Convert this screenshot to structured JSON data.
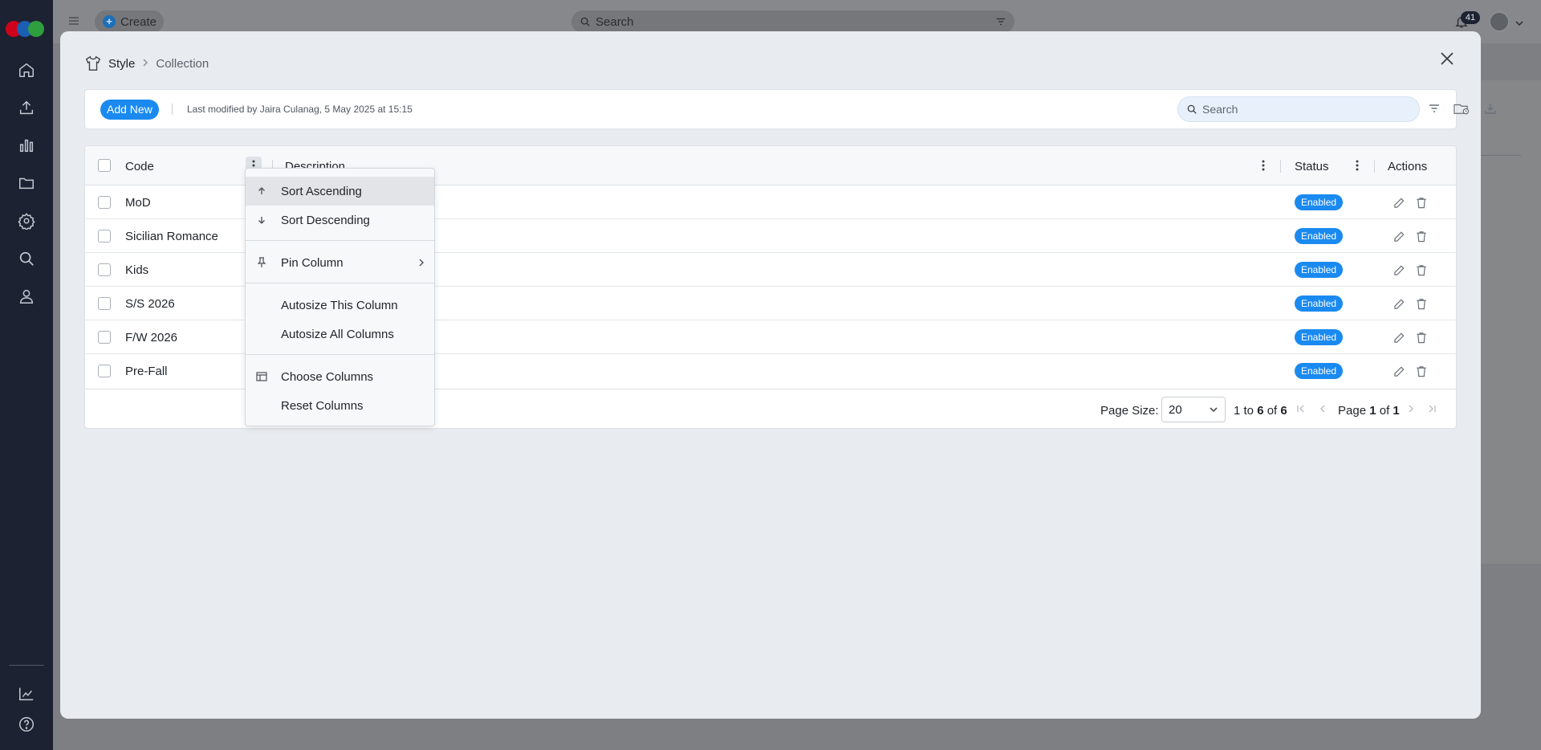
{
  "topbar": {
    "create_label": "Create",
    "search_placeholder": "Search",
    "notification_count": "41"
  },
  "modal": {
    "breadcrumb": {
      "root": "Style",
      "current": "Collection"
    },
    "toolbar": {
      "add_new_label": "Add New",
      "modified_text": "Last modified by Jaira Culanag, 5 May 2025 at 15:15",
      "search_placeholder": "Search"
    },
    "grid": {
      "columns": {
        "code": "Code",
        "description": "Description",
        "status": "Status",
        "actions": "Actions"
      },
      "rows": [
        {
          "code": "MoD",
          "status": "Enabled"
        },
        {
          "code": "Sicilian Romance",
          "status": "Enabled"
        },
        {
          "code": "Kids",
          "status": "Enabled"
        },
        {
          "code": "S/S 2026",
          "status": "Enabled"
        },
        {
          "code": "F/W 2026",
          "status": "Enabled"
        },
        {
          "code": "Pre-Fall",
          "status": "Enabled"
        }
      ]
    },
    "pager": {
      "page_size_label": "Page Size:",
      "page_size_value": "20",
      "range_prefix": "1",
      "range_to": "to",
      "range_end": "6",
      "range_of": "of",
      "range_total": "6",
      "page_label": "Page",
      "page_current": "1",
      "page_of": "of",
      "page_total": "1"
    },
    "column_menu": {
      "sort_ascending": "Sort Ascending",
      "sort_descending": "Sort Descending",
      "pin_column": "Pin Column",
      "autosize_this": "Autosize This Column",
      "autosize_all": "Autosize All Columns",
      "choose_columns": "Choose Columns",
      "reset_columns": "Reset Columns"
    }
  },
  "colors": {
    "accent": "#1a8af0",
    "rail": "#1c2232",
    "modal_bg": "#e8ebef",
    "logo": [
      "#d0021b",
      "#1a5fb4",
      "#2e9e3e"
    ]
  },
  "icons": {
    "rail": [
      "home-icon",
      "upload-icon",
      "chart-icon",
      "folder-icon",
      "gear-icon",
      "search-icon",
      "user-icon",
      "reports-icon",
      "help-icon"
    ]
  }
}
